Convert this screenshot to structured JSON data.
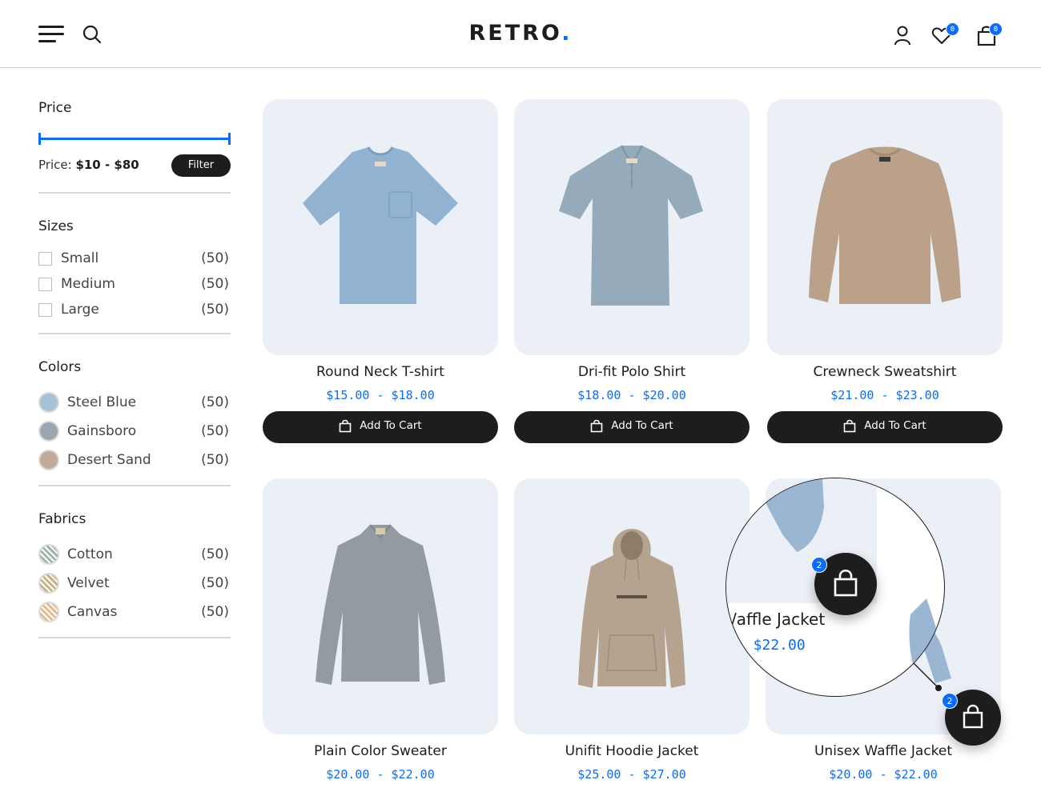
{
  "header": {
    "logo_text": "RETRO",
    "logo_dot": ".",
    "wishlist_count": "0",
    "cart_count": "0"
  },
  "sidebar": {
    "price": {
      "title": "Price",
      "label": "Price:",
      "range": "$10 - $80",
      "filter_button": "Filter",
      "range_selected": [
        0,
        1
      ]
    },
    "sizes": {
      "title": "Sizes",
      "items": [
        {
          "label": "Small",
          "count": "(50)",
          "checked": false
        },
        {
          "label": "Medium",
          "count": "(50)",
          "checked": false
        },
        {
          "label": "Large",
          "count": "(50)",
          "checked": false
        }
      ]
    },
    "colors": {
      "title": "Colors",
      "items": [
        {
          "label": "Steel Blue",
          "count": "(50)",
          "swatch": "#a6c3d6"
        },
        {
          "label": "Gainsboro",
          "count": "(50)",
          "swatch": "#9aa6b1"
        },
        {
          "label": "Desert Sand",
          "count": "(50)",
          "swatch": "#c2aa98"
        }
      ]
    },
    "fabrics": {
      "title": "Fabrics",
      "items": [
        {
          "label": "Cotton",
          "count": "(50)",
          "swatch": "#9fb3a6"
        },
        {
          "label": "Velvet",
          "count": "(50)",
          "swatch": "#c9b185"
        },
        {
          "label": "Canvas",
          "count": "(50)",
          "swatch": "#e6b98e"
        }
      ]
    }
  },
  "products": [
    {
      "name": "Round Neck T-shirt",
      "price": "$15.00 - $18.00",
      "button": "Add To Cart",
      "color": "#92b2d1"
    },
    {
      "name": "Dri-fit Polo Shirt",
      "price": "$18.00 - $20.00",
      "button": "Add To Cart",
      "color": "#95aabb"
    },
    {
      "name": "Crewneck Sweatshirt",
      "price": "$21.00 - $23.00",
      "button": "Add To Cart",
      "color": "#bba18a"
    },
    {
      "name": "Plain Color Sweater",
      "price": "$20.00 - $22.00",
      "color": "#949ba0"
    },
    {
      "name": "Unifit Hoodie Jacket",
      "price": "$25.00 - $27.00",
      "color": "#b5a28f"
    },
    {
      "name": "Unisex Waffle Jacket",
      "price": "$20.00 - $22.00",
      "color": "#9bb6d3"
    }
  ],
  "magnifier": {
    "name_fragment": "/affle Jacket",
    "price_fragment": "- $22.00",
    "cart_badge": "2"
  },
  "floating_cart": {
    "badge": "2"
  },
  "colors": {
    "accent": "#0a6cff",
    "dark": "#1d1d1d",
    "card_bg": "#ebf0f7"
  }
}
